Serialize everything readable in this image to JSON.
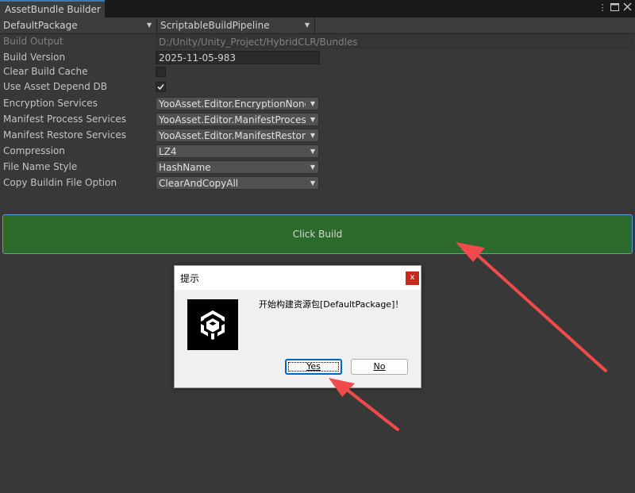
{
  "window": {
    "tab_title": "AssetBundle Builder",
    "menu_icon": "kebab-menu-icon",
    "maximize_icon": "maximize-icon",
    "close_icon": "close-icon"
  },
  "toolbar": {
    "package": "DefaultPackage",
    "pipeline": "ScriptableBuildPipeline"
  },
  "form": {
    "build_output_label": "Build Output",
    "build_output_value": "D:/Unity/Unity_Project/HybridCLR/Bundles",
    "build_version_label": "Build Version",
    "build_version_value": "2025-11-05-983",
    "clear_cache_label": "Clear Build Cache",
    "clear_cache_checked": false,
    "use_depend_db_label": "Use Asset Depend DB",
    "use_depend_db_checked": true,
    "encryption_label": "Encryption Services",
    "encryption_value": "YooAsset.Editor.EncryptionNone",
    "manifest_process_label": "Manifest Process Services",
    "manifest_process_value": "YooAsset.Editor.ManifestProcessNone",
    "manifest_restore_label": "Manifest Restore Services",
    "manifest_restore_value": "YooAsset.Editor.ManifestRestoreNone",
    "compression_label": "Compression",
    "compression_value": "LZ4",
    "file_name_style_label": "File Name Style",
    "file_name_style_value": "HashName",
    "copy_buildin_label": "Copy Buildin File Option",
    "copy_buildin_value": "ClearAndCopyAll"
  },
  "build_button": "Click Build",
  "dialog": {
    "title": "提示",
    "close": "x",
    "message": "开始构建资源包[DefaultPackage]！",
    "yes": "Yes",
    "no": "No"
  },
  "colors": {
    "build_button_bg": "#2b6a2b",
    "annotation_arrow": "#f04a4a"
  }
}
